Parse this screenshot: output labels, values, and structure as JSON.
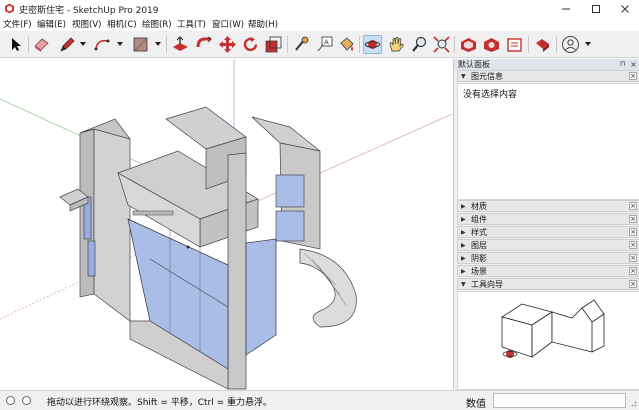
{
  "window": {
    "title": "史密斯住宅 - SketchUp Pro 2019",
    "minimize_icon": "minimize-icon",
    "maximize_icon": "maximize-icon",
    "close_icon": "close-icon"
  },
  "menu": {
    "items": [
      "文件(F)",
      "编辑(E)",
      "视图(V)",
      "相机(C)",
      "绘图(R)",
      "工具(T)",
      "窗口(W)",
      "帮助(H)"
    ]
  },
  "toolbar": {
    "tools": [
      "select-tool",
      "eraser-tool",
      "line-tool",
      "arc-tool",
      "shape-tool",
      "push-pull-tool",
      "follow-me-tool",
      "move-tool",
      "rotate-tool",
      "scale-tool",
      "tape-measure-tool",
      "text-tool",
      "paint-bucket-tool",
      "orbit-tool",
      "pan-tool",
      "zoom-tool",
      "zoom-extents-tool",
      "3d-warehouse-tool",
      "extension-warehouse-tool",
      "layout-tool",
      "extension-manager-tool",
      "account-tool"
    ],
    "active_tool": "orbit-tool",
    "colors": {
      "accent_red": "#c62a2a",
      "active_bg": "#c9dff5"
    }
  },
  "model": {
    "background": "#ffffff",
    "wall_color": "#d7d7d7",
    "glass_color": "#a9bde6",
    "axis_red": "#d9a0a0",
    "axis_green": "#8fc48f",
    "axis_blue": "#9c9cd8"
  },
  "tray": {
    "title": "默认面板",
    "entity_info": {
      "label": "图元信息",
      "content": "没有选择内容"
    },
    "panels": [
      "材质",
      "组件",
      "样式",
      "图层",
      "阴影",
      "场景"
    ],
    "instructor": {
      "label": "工具向导"
    }
  },
  "status": {
    "hint": "拖动以进行环绕观察。Shift = 平移，Ctrl = 重力悬浮。",
    "measurements_label": "数值",
    "measurements_value": ""
  }
}
